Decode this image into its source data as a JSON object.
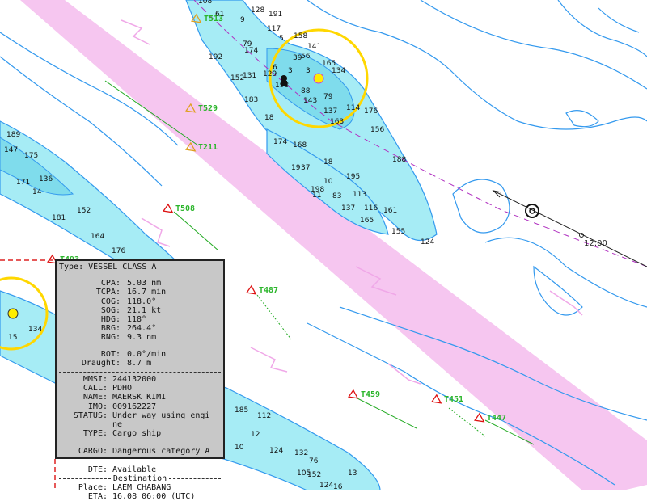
{
  "colors": {
    "shallow": "#a6ecf5",
    "deep_contour": "#3399ee",
    "lane": "#f6c6f0",
    "target": "#dd1111",
    "target_label": "#2bb52b",
    "cpa_ring": "#ffd700"
  },
  "soundings": [
    "108",
    "61",
    "128",
    "191",
    "9",
    "117",
    "5",
    "158",
    "141",
    "79",
    "174",
    "56",
    "192",
    "39",
    "165",
    "134",
    "6",
    "3",
    "3",
    "131",
    "152",
    "129",
    "193",
    "88",
    "143",
    "79",
    "183",
    "137",
    "114",
    "176",
    "18",
    "163",
    "156",
    "174",
    "168",
    "188",
    "19",
    "37",
    "18",
    "195",
    "198",
    "10",
    "11",
    "83",
    "113",
    "137",
    "116",
    "161",
    "165",
    "155",
    "124",
    "189",
    "147",
    "175",
    "171",
    "136",
    "14",
    "152",
    "181",
    "164",
    "176",
    "15",
    "134",
    "185",
    "112",
    "12",
    "10",
    "124",
    "132",
    "76",
    "105",
    "16",
    "13",
    "152",
    "124"
  ],
  "targets": [
    {
      "id": "T513",
      "label": "T513"
    },
    {
      "id": "T529",
      "label": "T529"
    },
    {
      "id": "T211",
      "label": "T211"
    },
    {
      "id": "T508",
      "label": "T508"
    },
    {
      "id": "T493",
      "label": "T493"
    },
    {
      "id": "T487",
      "label": "T487"
    },
    {
      "id": "T459",
      "label": "T459"
    },
    {
      "id": "T451",
      "label": "T451"
    },
    {
      "id": "T447",
      "label": "T447"
    }
  ],
  "own_ship": {
    "time_mark": "12:00"
  },
  "popup": {
    "type_label": "Type:",
    "type_value": "VESSEL CLASS A",
    "nav": [
      {
        "k": "CPA:",
        "v": "5.03 nm"
      },
      {
        "k": "TCPA:",
        "v": "16.7 min"
      },
      {
        "k": "COG:",
        "v": "118.0°"
      },
      {
        "k": "SOG:",
        "v": "21.1 kt"
      },
      {
        "k": "HDG:",
        "v": "118°"
      },
      {
        "k": "BRG:",
        "v": "264.4°"
      },
      {
        "k": "RNG:",
        "v": "9.3 nm"
      }
    ],
    "motion": [
      {
        "k": "ROT:",
        "v": "0.0°/min"
      },
      {
        "k": "Draught:",
        "v": "8.7 m"
      }
    ],
    "static": [
      {
        "k": "MMSI:",
        "v": "244132000"
      },
      {
        "k": "CALL:",
        "v": "PDHO"
      },
      {
        "k": "NAME:",
        "v": "MAERSK KIMI"
      },
      {
        "k": "IMO:",
        "v": "009162227"
      },
      {
        "k": "STATUS:",
        "v": "Under way using engi\nne"
      },
      {
        "k": "TYPE:",
        "v": "Cargo ship"
      },
      {
        "k": "CARGO:",
        "v": "Dangerous category A"
      },
      {
        "k": "DTE:",
        "v": "Available"
      }
    ],
    "destination_header": "Destination",
    "place_label": "Place:",
    "place_value": "LAEM CHABANG",
    "eta_label": "ETA:",
    "eta_value": "16.08 06:00 (UTC)"
  }
}
